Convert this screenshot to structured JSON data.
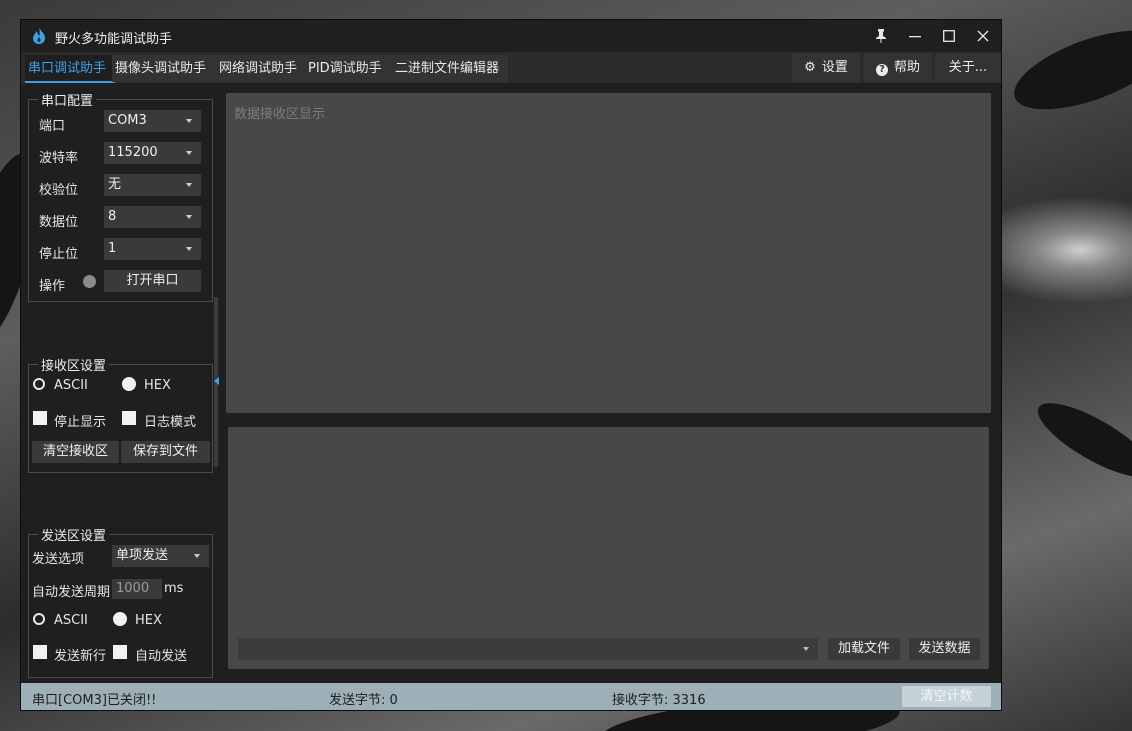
{
  "window": {
    "title": "野火多功能调试助手"
  },
  "tabs": [
    {
      "label": "串口调试助手",
      "active": true
    },
    {
      "label": "摄像头调试助手"
    },
    {
      "label": "网络调试助手"
    },
    {
      "label": "PID调试助手"
    },
    {
      "label": "二进制文件编辑器"
    }
  ],
  "top_actions": {
    "settings": "设置",
    "help": "帮助",
    "about": "关于..."
  },
  "serial_config": {
    "title": "串口配置",
    "port": {
      "label": "端口",
      "value": "COM3"
    },
    "baud": {
      "label": "波特率",
      "value": "115200"
    },
    "parity": {
      "label": "校验位",
      "value": "无"
    },
    "databits": {
      "label": "数据位",
      "value": "8"
    },
    "stopbits": {
      "label": "停止位",
      "value": "1"
    },
    "operation": {
      "label": "操作",
      "button": "打开串口",
      "led_color": "#8a8a8a"
    }
  },
  "receive_settings": {
    "title": "接收区设置",
    "ascii": "ASCII",
    "hex": "HEX",
    "selected": "HEX",
    "stop_display": "停止显示",
    "log_mode": "日志模式",
    "clear_button": "清空接收区",
    "save_button": "保存到文件"
  },
  "send_settings": {
    "title": "发送区设置",
    "option_label": "发送选项",
    "option_value": "单项发送",
    "period_label": "自动发送周期",
    "period_value": "1000",
    "period_unit": "ms",
    "ascii": "ASCII",
    "hex": "HEX",
    "selected": "HEX",
    "newline": "发送新行",
    "auto_send": "自动发送"
  },
  "receive_area": {
    "placeholder": "数据接收区显示"
  },
  "send_area": {
    "load_file": "加载文件",
    "send_data": "发送数据"
  },
  "status": {
    "port_state": "串口[COM3]已关闭!!",
    "sent_bytes": "发送字节: 0",
    "received_bytes": "接收字节: 3316",
    "clear_count": "清空计数"
  },
  "colors": {
    "accent": "#3ea2e8",
    "status_bar": "#9db0b7"
  }
}
